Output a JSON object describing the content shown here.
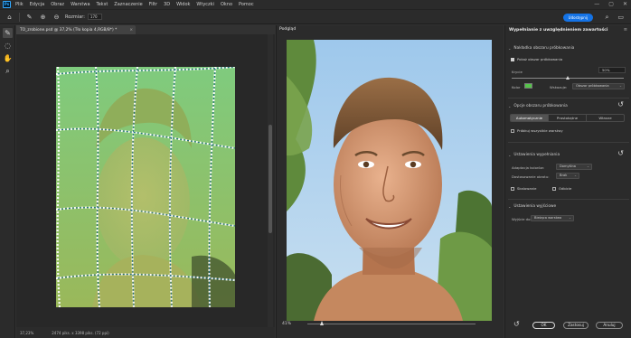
{
  "app": {
    "logo": "Ps",
    "menu": [
      "Plik",
      "Edycja",
      "Obraz",
      "Warstwa",
      "Tekst",
      "Zaznaczenie",
      "Filtr",
      "3D",
      "Widok",
      "Wtyczki",
      "Okno",
      "Pomoc"
    ]
  },
  "options_bar": {
    "size_label": "Rozmiar:",
    "size_value": "170",
    "share_label": "Udostępnij"
  },
  "document": {
    "tab_title": "TO_zrobione.psd @ 37,2% (Tło kopia 4,RGB/8*) *",
    "status_zoom": "37,23%",
    "status_dims": "2474 piks. x 3398 piks. (72 ppi)"
  },
  "preview": {
    "title": "Podgląd",
    "zoom": "41%",
    "zoom_level": 0.09
  },
  "right_panel": {
    "title": "Wypełnianie z uwzględnieniem zawartości",
    "sampling_section": {
      "header": "Nakładka obszaru próbkowania",
      "show_checkbox_label": "Pokaż obszar próbkowania",
      "show_checked": true,
      "opacity_label": "Krycie",
      "opacity_value": "50%",
      "opacity_level": 0.5,
      "color_label": "Kolor",
      "color_value": "#55c34a",
      "indicates_label": "Wskazuje:",
      "indicates_value": "Obszar próbkowania"
    },
    "sampling_options": {
      "header": "Opcje obszaru próbkowania",
      "modes": [
        "Automatycznie",
        "Prostokątne",
        "Własne"
      ],
      "active_mode": 0,
      "all_layers_label": "Próbkuj wszystkie warstwy",
      "all_layers_checked": false
    },
    "fill_settings": {
      "header": "Ustawienia wypełniania",
      "color_adapt_label": "Adaptacja kolorów:",
      "color_adapt_value": "Domyślna",
      "rotation_label": "Dostosowanie obrotu:",
      "rotation_value": "Brak",
      "scale_label": "Skalowanie",
      "mirror_label": "Odbicie"
    },
    "output_settings": {
      "header": "Ustawienia wyjściowe",
      "output_label": "Wyjście do:",
      "output_value": "Bieżąca warstwa"
    },
    "buttons": {
      "ok": "OK",
      "apply": "Zastosuj",
      "cancel": "Anuluj"
    }
  }
}
